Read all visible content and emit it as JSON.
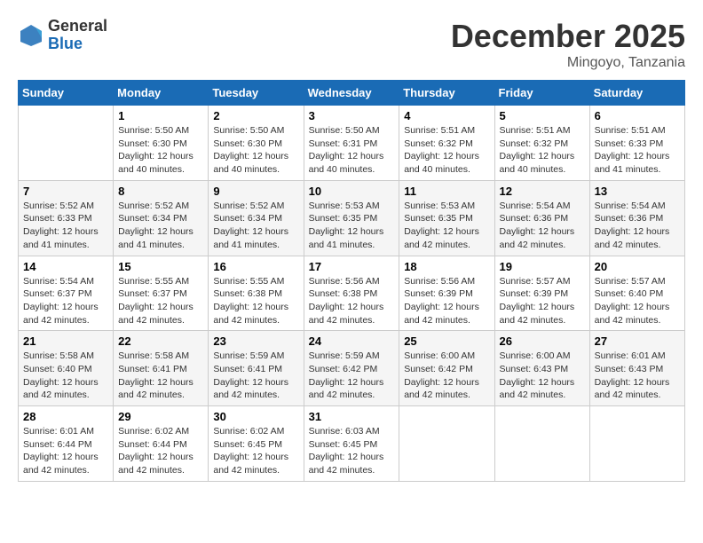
{
  "logo": {
    "general": "General",
    "blue": "Blue"
  },
  "title": "December 2025",
  "location": "Mingoyo, Tanzania",
  "days_of_week": [
    "Sunday",
    "Monday",
    "Tuesday",
    "Wednesday",
    "Thursday",
    "Friday",
    "Saturday"
  ],
  "weeks": [
    [
      {
        "day": "",
        "info": ""
      },
      {
        "day": "1",
        "info": "Sunrise: 5:50 AM\nSunset: 6:30 PM\nDaylight: 12 hours\nand 40 minutes."
      },
      {
        "day": "2",
        "info": "Sunrise: 5:50 AM\nSunset: 6:30 PM\nDaylight: 12 hours\nand 40 minutes."
      },
      {
        "day": "3",
        "info": "Sunrise: 5:50 AM\nSunset: 6:31 PM\nDaylight: 12 hours\nand 40 minutes."
      },
      {
        "day": "4",
        "info": "Sunrise: 5:51 AM\nSunset: 6:32 PM\nDaylight: 12 hours\nand 40 minutes."
      },
      {
        "day": "5",
        "info": "Sunrise: 5:51 AM\nSunset: 6:32 PM\nDaylight: 12 hours\nand 40 minutes."
      },
      {
        "day": "6",
        "info": "Sunrise: 5:51 AM\nSunset: 6:33 PM\nDaylight: 12 hours\nand 41 minutes."
      }
    ],
    [
      {
        "day": "7",
        "info": "Sunrise: 5:52 AM\nSunset: 6:33 PM\nDaylight: 12 hours\nand 41 minutes."
      },
      {
        "day": "8",
        "info": "Sunrise: 5:52 AM\nSunset: 6:34 PM\nDaylight: 12 hours\nand 41 minutes."
      },
      {
        "day": "9",
        "info": "Sunrise: 5:52 AM\nSunset: 6:34 PM\nDaylight: 12 hours\nand 41 minutes."
      },
      {
        "day": "10",
        "info": "Sunrise: 5:53 AM\nSunset: 6:35 PM\nDaylight: 12 hours\nand 41 minutes."
      },
      {
        "day": "11",
        "info": "Sunrise: 5:53 AM\nSunset: 6:35 PM\nDaylight: 12 hours\nand 42 minutes."
      },
      {
        "day": "12",
        "info": "Sunrise: 5:54 AM\nSunset: 6:36 PM\nDaylight: 12 hours\nand 42 minutes."
      },
      {
        "day": "13",
        "info": "Sunrise: 5:54 AM\nSunset: 6:36 PM\nDaylight: 12 hours\nand 42 minutes."
      }
    ],
    [
      {
        "day": "14",
        "info": "Sunrise: 5:54 AM\nSunset: 6:37 PM\nDaylight: 12 hours\nand 42 minutes."
      },
      {
        "day": "15",
        "info": "Sunrise: 5:55 AM\nSunset: 6:37 PM\nDaylight: 12 hours\nand 42 minutes."
      },
      {
        "day": "16",
        "info": "Sunrise: 5:55 AM\nSunset: 6:38 PM\nDaylight: 12 hours\nand 42 minutes."
      },
      {
        "day": "17",
        "info": "Sunrise: 5:56 AM\nSunset: 6:38 PM\nDaylight: 12 hours\nand 42 minutes."
      },
      {
        "day": "18",
        "info": "Sunrise: 5:56 AM\nSunset: 6:39 PM\nDaylight: 12 hours\nand 42 minutes."
      },
      {
        "day": "19",
        "info": "Sunrise: 5:57 AM\nSunset: 6:39 PM\nDaylight: 12 hours\nand 42 minutes."
      },
      {
        "day": "20",
        "info": "Sunrise: 5:57 AM\nSunset: 6:40 PM\nDaylight: 12 hours\nand 42 minutes."
      }
    ],
    [
      {
        "day": "21",
        "info": "Sunrise: 5:58 AM\nSunset: 6:40 PM\nDaylight: 12 hours\nand 42 minutes."
      },
      {
        "day": "22",
        "info": "Sunrise: 5:58 AM\nSunset: 6:41 PM\nDaylight: 12 hours\nand 42 minutes."
      },
      {
        "day": "23",
        "info": "Sunrise: 5:59 AM\nSunset: 6:41 PM\nDaylight: 12 hours\nand 42 minutes."
      },
      {
        "day": "24",
        "info": "Sunrise: 5:59 AM\nSunset: 6:42 PM\nDaylight: 12 hours\nand 42 minutes."
      },
      {
        "day": "25",
        "info": "Sunrise: 6:00 AM\nSunset: 6:42 PM\nDaylight: 12 hours\nand 42 minutes."
      },
      {
        "day": "26",
        "info": "Sunrise: 6:00 AM\nSunset: 6:43 PM\nDaylight: 12 hours\nand 42 minutes."
      },
      {
        "day": "27",
        "info": "Sunrise: 6:01 AM\nSunset: 6:43 PM\nDaylight: 12 hours\nand 42 minutes."
      }
    ],
    [
      {
        "day": "28",
        "info": "Sunrise: 6:01 AM\nSunset: 6:44 PM\nDaylight: 12 hours\nand 42 minutes."
      },
      {
        "day": "29",
        "info": "Sunrise: 6:02 AM\nSunset: 6:44 PM\nDaylight: 12 hours\nand 42 minutes."
      },
      {
        "day": "30",
        "info": "Sunrise: 6:02 AM\nSunset: 6:45 PM\nDaylight: 12 hours\nand 42 minutes."
      },
      {
        "day": "31",
        "info": "Sunrise: 6:03 AM\nSunset: 6:45 PM\nDaylight: 12 hours\nand 42 minutes."
      },
      {
        "day": "",
        "info": ""
      },
      {
        "day": "",
        "info": ""
      },
      {
        "day": "",
        "info": ""
      }
    ]
  ]
}
